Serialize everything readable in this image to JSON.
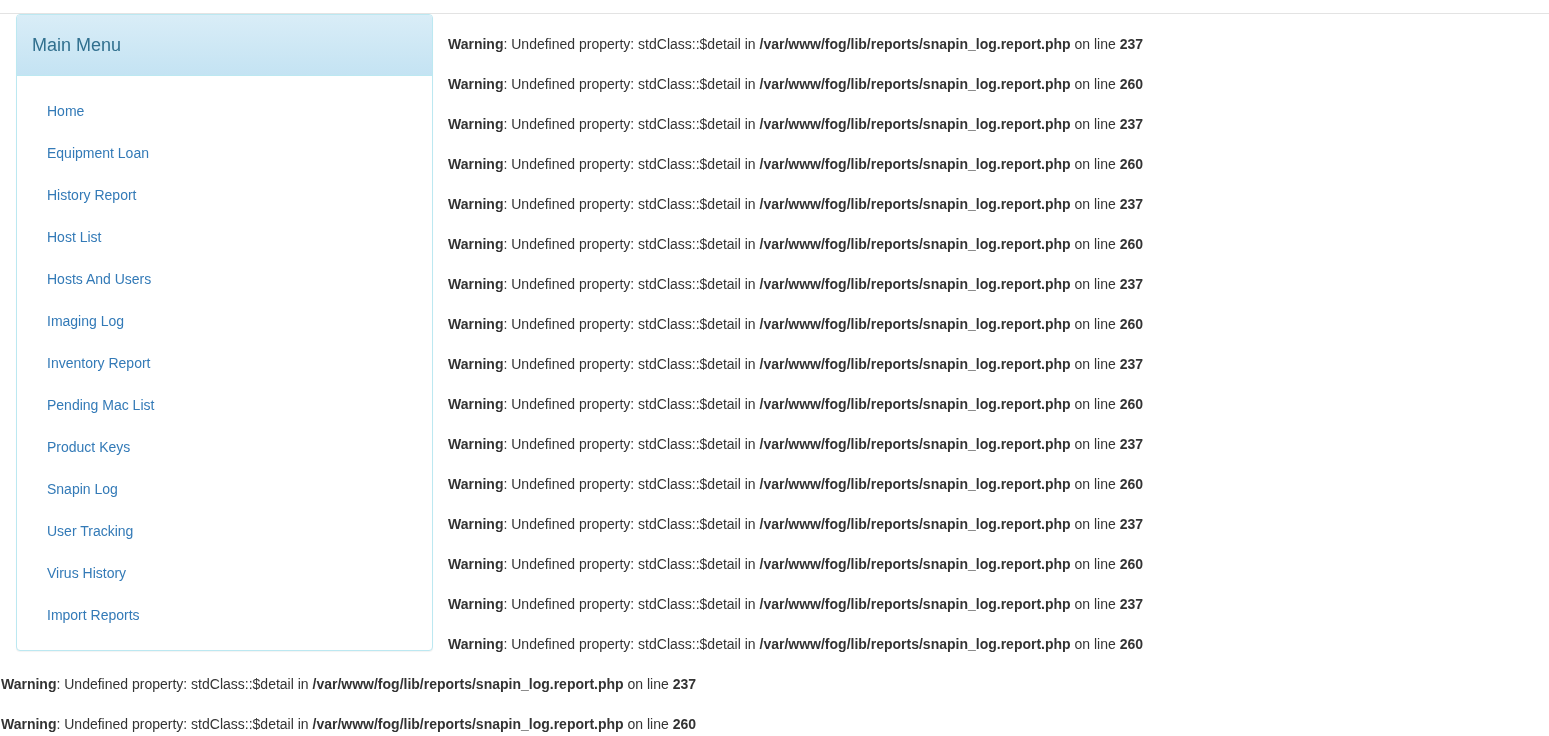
{
  "sidebar": {
    "title": "Main Menu",
    "items": [
      "Home",
      "Equipment Loan",
      "History Report",
      "Host List",
      "Hosts And Users",
      "Imaging Log",
      "Inventory Report",
      "Pending Mac List",
      "Product Keys",
      "Snapin Log",
      "User Tracking",
      "Virus History",
      "Import Reports"
    ]
  },
  "warnings": [
    "**Warning**: Undefined property: stdClass::$detail in **/var/www/fog/lib/reports/snapin_log.report.php** on line **237**",
    "**Warning**: Undefined property: stdClass::$detail in **/var/www/fog/lib/reports/snapin_log.report.php** on line **260**",
    "**Warning**: Undefined property: stdClass::$detail in **/var/www/fog/lib/reports/snapin_log.report.php** on line **237**",
    "**Warning**: Undefined property: stdClass::$detail in **/var/www/fog/lib/reports/snapin_log.report.php** on line **260**",
    "**Warning**: Undefined property: stdClass::$detail in **/var/www/fog/lib/reports/snapin_log.report.php** on line **237**",
    "**Warning**: Undefined property: stdClass::$detail in **/var/www/fog/lib/reports/snapin_log.report.php** on line **260**",
    "**Warning**: Undefined property: stdClass::$detail in **/var/www/fog/lib/reports/snapin_log.report.php** on line **237**",
    "**Warning**: Undefined property: stdClass::$detail in **/var/www/fog/lib/reports/snapin_log.report.php** on line **260**",
    "**Warning**: Undefined property: stdClass::$detail in **/var/www/fog/lib/reports/snapin_log.report.php** on line **237**",
    "**Warning**: Undefined property: stdClass::$detail in **/var/www/fog/lib/reports/snapin_log.report.php** on line **260**",
    "**Warning**: Undefined property: stdClass::$detail in **/var/www/fog/lib/reports/snapin_log.report.php** on line **237**",
    "**Warning**: Undefined property: stdClass::$detail in **/var/www/fog/lib/reports/snapin_log.report.php** on line **260**",
    "**Warning**: Undefined property: stdClass::$detail in **/var/www/fog/lib/reports/snapin_log.report.php** on line **237**",
    "**Warning**: Undefined property: stdClass::$detail in **/var/www/fog/lib/reports/snapin_log.report.php** on line **260**",
    "**Warning**: Undefined property: stdClass::$detail in **/var/www/fog/lib/reports/snapin_log.report.php** on line **237**",
    "**Warning**: Undefined property: stdClass::$detail in **/var/www/fog/lib/reports/snapin_log.report.php** on line **260**",
    "**Warning**: Undefined property: stdClass::$detail in **/var/www/fog/lib/reports/snapin_log.report.php** on line **237**",
    "**Warning**: Undefined property: stdClass::$detail in **/var/www/fog/lib/reports/snapin_log.report.php** on line **260**"
  ]
}
